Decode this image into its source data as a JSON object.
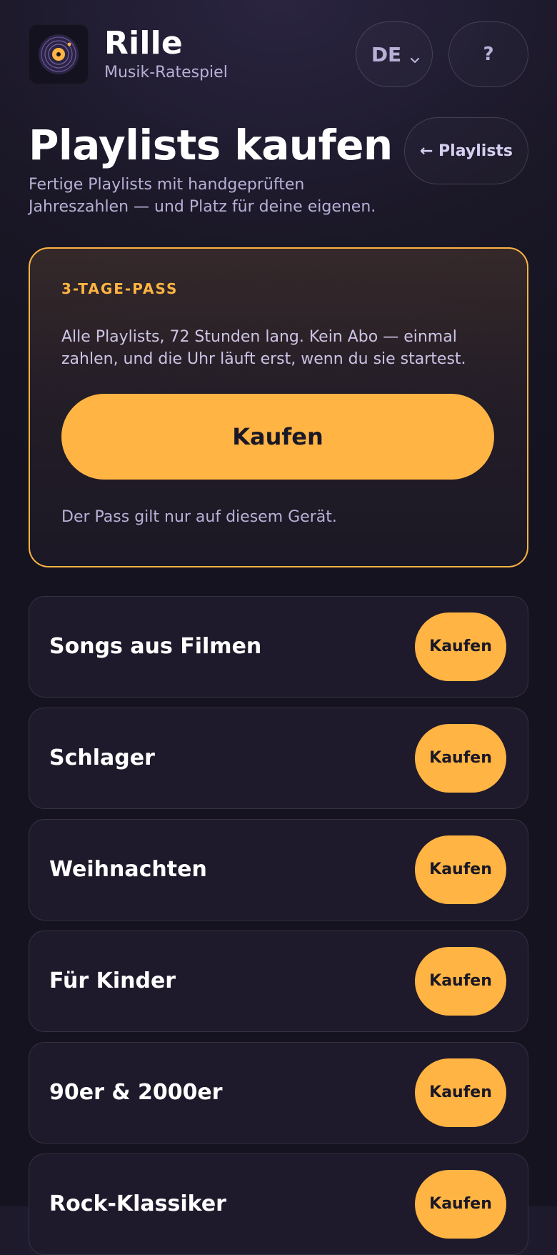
{
  "app": {
    "title": "Rille",
    "subtitle": "Musik-Ratespiel",
    "icon": "vinyl-record-icon"
  },
  "header": {
    "language_label": "DE",
    "language_icon": "chevron-down-icon",
    "help_label": "?"
  },
  "page": {
    "title": "Playlists kaufen",
    "description": "Fertige Playlists mit handgeprüften Jahreszahlen — und Platz für deine eigenen.",
    "back_label": "← Playlists"
  },
  "pass": {
    "kicker": "3-TAGE-PASS",
    "text": "Alle Playlists, 72 Stunden lang. Kein Abo — einmal zahlen, und die Uhr läuft erst, wenn du sie startest.",
    "buy_label": "Kaufen",
    "note": "Der Pass gilt nur auf diesem Gerät."
  },
  "playlists": [
    {
      "name": "Songs aus Filmen",
      "buy_label": "Kaufen"
    },
    {
      "name": "Schlager",
      "buy_label": "Kaufen"
    },
    {
      "name": "Weihnachten",
      "buy_label": "Kaufen"
    },
    {
      "name": "Für Kinder",
      "buy_label": "Kaufen"
    },
    {
      "name": "90er & 2000er",
      "buy_label": "Kaufen"
    },
    {
      "name": "Rock-Klassiker",
      "buy_label": "Kaufen"
    }
  ],
  "colors": {
    "accent": "#ffb443",
    "background": "#1a1726",
    "card": "#1e1a2b",
    "muted_text": "#b9b0d6"
  }
}
